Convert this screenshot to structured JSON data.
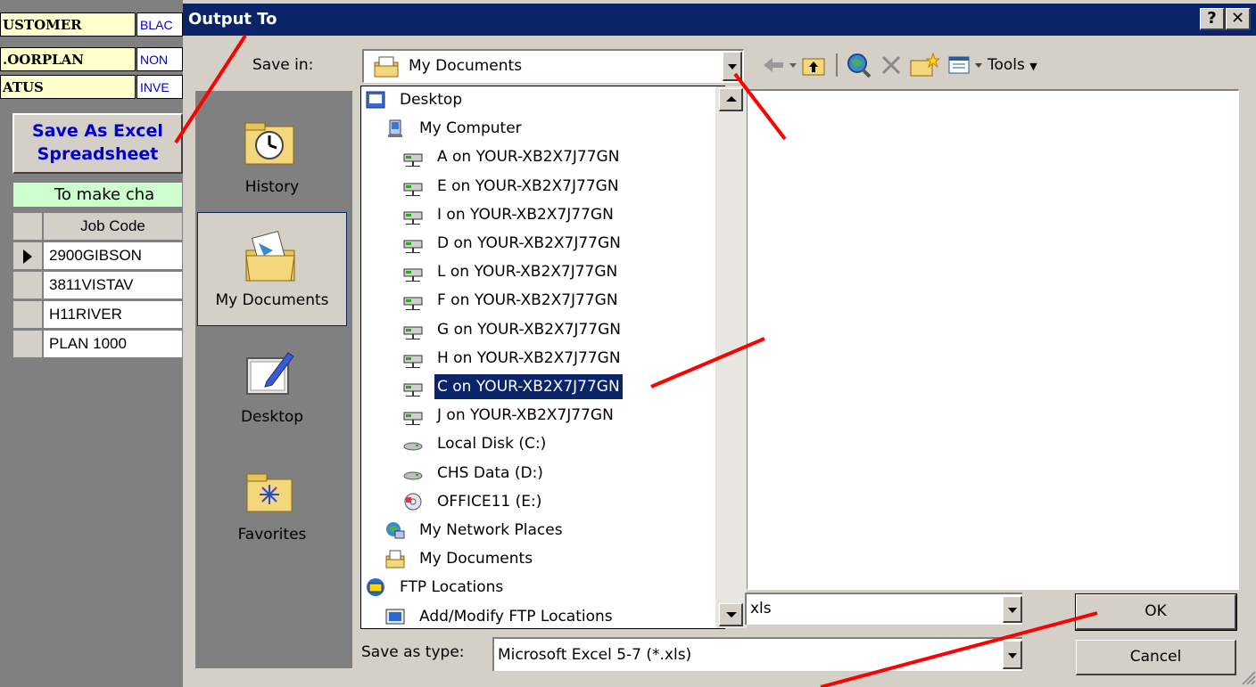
{
  "form": {
    "fields": [
      {
        "label": "USTOMER",
        "value": "BLAC"
      },
      {
        "label": ".OORPLAN",
        "value": "NON"
      },
      {
        "label": "ATUS",
        "value": "INVE"
      }
    ],
    "save_button": {
      "line1": "Save As Excel",
      "line2": "Spreadsheet"
    },
    "notice": "To make cha",
    "grid": {
      "header": "Job Code",
      "rows": [
        "2900GIBSON",
        "3811VISTAV",
        "H11RIVER",
        "PLAN 1000"
      ]
    }
  },
  "dialog": {
    "title": "Output To",
    "help_label": "?",
    "close_label": "✕",
    "save_in_label": "Save in:",
    "save_in_value": "My Documents",
    "tools_label": "Tools",
    "places": [
      {
        "label": "History",
        "icon": "history-icon"
      },
      {
        "label": "My Documents",
        "icon": "my-documents-icon"
      },
      {
        "label": "Desktop",
        "icon": "desktop-icon"
      },
      {
        "label": "Favorites",
        "icon": "favorites-icon"
      }
    ],
    "dropdown_items": [
      {
        "label": "Desktop",
        "icon": "desktop-small-icon"
      },
      {
        "label": "My Computer",
        "icon": "my-computer-icon"
      },
      {
        "label": "A on YOUR-XB2X7J77GN",
        "icon": "network-drive-icon"
      },
      {
        "label": "E on YOUR-XB2X7J77GN",
        "icon": "network-drive-icon"
      },
      {
        "label": "I on YOUR-XB2X7J77GN",
        "icon": "network-drive-icon"
      },
      {
        "label": "D on YOUR-XB2X7J77GN",
        "icon": "network-drive-icon"
      },
      {
        "label": "L on YOUR-XB2X7J77GN",
        "icon": "network-drive-icon"
      },
      {
        "label": "F on YOUR-XB2X7J77GN",
        "icon": "network-drive-icon"
      },
      {
        "label": "G on YOUR-XB2X7J77GN",
        "icon": "network-drive-icon"
      },
      {
        "label": "H on YOUR-XB2X7J77GN",
        "icon": "network-drive-icon"
      },
      {
        "label": "C on YOUR-XB2X7J77GN",
        "icon": "network-drive-icon",
        "selected": true
      },
      {
        "label": "J on YOUR-XB2X7J77GN",
        "icon": "network-drive-icon"
      },
      {
        "label": "Local Disk (C:)",
        "icon": "local-disk-icon"
      },
      {
        "label": "CHS Data (D:)",
        "icon": "local-disk-icon"
      },
      {
        "label": "OFFICE11 (E:)",
        "icon": "cd-drive-icon"
      },
      {
        "label": "My Network Places",
        "icon": "network-places-icon"
      },
      {
        "label": "My Documents",
        "icon": "my-documents-small-icon"
      },
      {
        "label": "FTP Locations",
        "icon": "ftp-locations-icon"
      },
      {
        "label": "Add/Modify FTP Locations",
        "icon": "ftp-add-icon"
      }
    ],
    "file_name_value": "xls",
    "save_as_type_label": "Save as type:",
    "save_as_type_value": "Microsoft Excel 5-7 (*.xls)",
    "ok_label": "OK",
    "cancel_label": "Cancel"
  },
  "colors": {
    "titlebar": "#0a246a",
    "dialog_bg": "#d4d0c8",
    "selection": "#0a246a",
    "annotation": "#ff0000",
    "label_bg": "#ffffcc",
    "notice_bg": "#ccffcc"
  }
}
